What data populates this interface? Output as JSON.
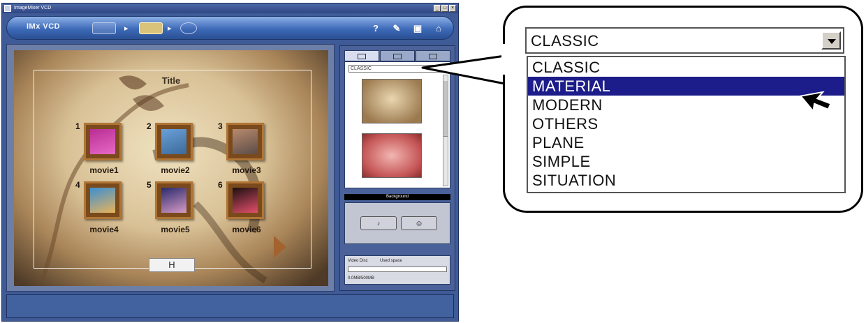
{
  "window": {
    "title": "ImageMixer VCD",
    "controls": [
      "_",
      "□",
      "×"
    ]
  },
  "toolbar": {
    "mode_label": "IMx VCD",
    "icons": [
      "help-icon",
      "tools-icon",
      "save-icon",
      "exit-icon"
    ],
    "help_label": "?"
  },
  "preview": {
    "menu_title": "Title",
    "button_label": "H",
    "movies": [
      {
        "number": "1",
        "label": "movie1",
        "colors": [
          "#b92d93",
          "#e66ac6"
        ]
      },
      {
        "number": "2",
        "label": "movie2",
        "colors": [
          "#6a9fd8",
          "#3c6b9a"
        ]
      },
      {
        "number": "3",
        "label": "movie3",
        "colors": [
          "#b88a6d",
          "#5b4c47"
        ]
      },
      {
        "number": "4",
        "label": "movie4",
        "colors": [
          "#3c8fd2",
          "#e8b35a"
        ]
      },
      {
        "number": "5",
        "label": "movie5",
        "colors": [
          "#2a2a6b",
          "#d69bc6"
        ]
      },
      {
        "number": "6",
        "label": "movie6",
        "colors": [
          "#1c1010",
          "#e34f6b"
        ]
      }
    ]
  },
  "panel": {
    "selected_style": "CLASSIC",
    "background_label": "Background",
    "bg_buttons": [
      "♪",
      "◎"
    ],
    "disc": {
      "label": "Video Disc",
      "used_label": "Used space",
      "value": "0.0MB/500MB"
    }
  },
  "dropdown": {
    "selected_value": "CLASSIC",
    "highlighted": "MATERIAL",
    "options": [
      "CLASSIC",
      "MATERIAL",
      "MODERN",
      "OTHERS",
      "PLANE",
      "SIMPLE",
      "SITUATION"
    ]
  },
  "colors": {
    "window_blue": "#3e5a97",
    "selection": "#1c1c8a"
  }
}
